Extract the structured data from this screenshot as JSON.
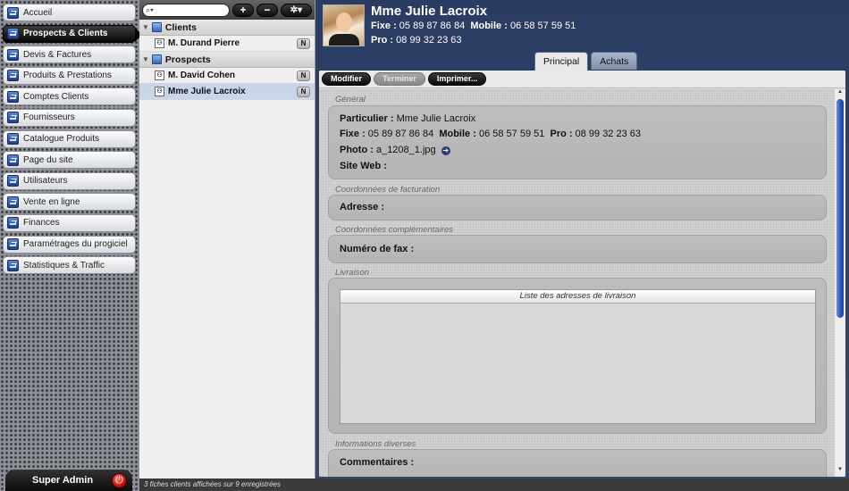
{
  "nav": {
    "items": [
      {
        "label": "Accueil",
        "active": false
      },
      {
        "label": "Prospects & Clients",
        "active": true
      },
      {
        "label": "Devis & Factures",
        "active": false
      },
      {
        "label": "Produits & Prestations",
        "active": false
      },
      {
        "label": "Comptes Clients",
        "active": false
      },
      {
        "label": "Fournisseurs",
        "active": false
      },
      {
        "label": "Catalogue Produits",
        "active": false
      },
      {
        "label": "Page du site",
        "active": false
      },
      {
        "label": "Utilisateurs",
        "active": false
      },
      {
        "label": "Vente en ligne",
        "active": false
      },
      {
        "label": "Finances",
        "active": false
      },
      {
        "label": "Paramétrages du progiciel",
        "active": false
      },
      {
        "label": "Statistiques & Traffic",
        "active": false
      }
    ],
    "admin_label": "Super Admin",
    "power_icon": "power-icon"
  },
  "list": {
    "search": {
      "placeholder": "",
      "value": ""
    },
    "add_label": "+",
    "remove_label": "−",
    "settings_label": "✲▾",
    "groups": [
      {
        "label": "Clients",
        "records": [
          {
            "name": "M. Durand Pierre",
            "badge": "N",
            "selected": false
          }
        ]
      },
      {
        "label": "Prospects",
        "records": [
          {
            "name": "M. David Cohen",
            "badge": "N",
            "selected": false
          },
          {
            "name": "Mme Julie Lacroix",
            "badge": "N",
            "selected": true
          }
        ]
      }
    ],
    "status": "3 fiches clients affichées sur 9 enregistrées"
  },
  "detail": {
    "header": {
      "name": "Mme Julie Lacroix",
      "fixe_label": "Fixe :",
      "fixe": "05 89 87 86 84",
      "mobile_label": "Mobile :",
      "mobile": "06 58 57 59 51",
      "pro_label": "Pro :",
      "pro": "08 99 32 23 63"
    },
    "tabs": [
      "Principal",
      "Achats"
    ],
    "actions": {
      "modifier": "Modifier",
      "terminer": "Terminer",
      "imprimer": "Imprimer..."
    },
    "sections": {
      "general": {
        "label": "Général",
        "particulier_label": "Particulier :",
        "particulier": "Mme Julie Lacroix",
        "fixe_label": "Fixe :",
        "fixe": "05 89 87 86 84",
        "mobile_label": "Mobile :",
        "mobile": "06 58 57 59 51",
        "pro_label": "Pro :",
        "pro": "08 99 32 23 63",
        "photo_label": "Photo :",
        "photo": "a_1208_1.jpg",
        "site_label": "Site Web :",
        "site": ""
      },
      "facturation": {
        "label": "Coordonnées de facturation",
        "adresse_label": "Adresse :"
      },
      "complementaires": {
        "label": "Coordonnées complémentaires",
        "fax_label": "Numéro de fax :"
      },
      "livraison": {
        "label": "Livraison",
        "list_header": "Liste des adresses de livraison"
      },
      "diverses": {
        "label": "Informations diverses",
        "commentaires_label": "Commentaires :"
      }
    }
  }
}
